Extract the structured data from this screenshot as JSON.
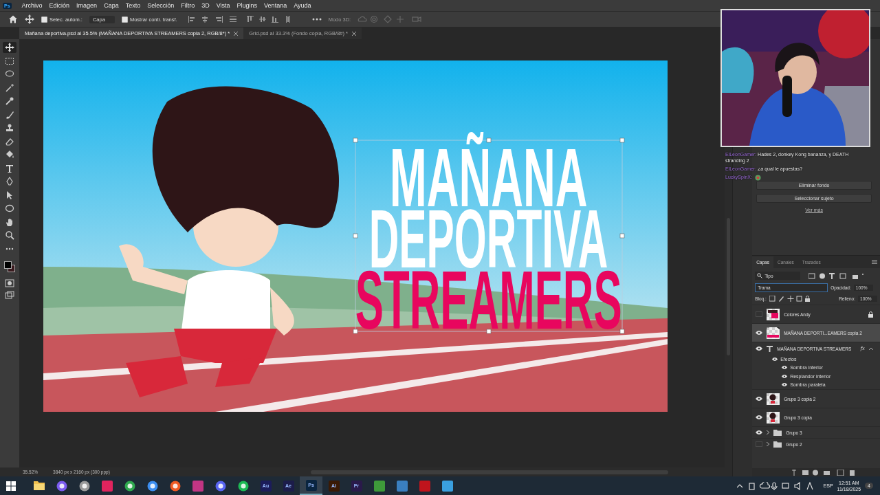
{
  "menu_bar": {
    "app_logo": "Ps",
    "items": [
      "Archivo",
      "Edición",
      "Imagen",
      "Capa",
      "Texto",
      "Selección",
      "Filtro",
      "3D",
      "Vista",
      "Plugins",
      "Ventana",
      "Ayuda"
    ]
  },
  "options_bar": {
    "auto_select": {
      "label": "Selec. autom.:",
      "checked": true
    },
    "target": "Capa",
    "transform_controls": {
      "label": "Mostrar contr. transf.",
      "checked": true
    },
    "mode_3d": "Modo 3D:"
  },
  "tabs": [
    {
      "label": "Mañana deportiva.psd al 35.5% (MAÑANA DEPORTIVA STREAMERS copia 2, RGB/8*) *",
      "selected": true
    },
    {
      "label": "Grid.psd al 33.3% (Fondo copia, RGB/8#) *",
      "selected": false
    }
  ],
  "canvas": {
    "kind": "picture",
    "title_lines": [
      {
        "text": "MAÑANA",
        "accent": false
      },
      {
        "text": "DEPORTIVA",
        "accent": false
      },
      {
        "text": "STREAMERS",
        "accent": true
      }
    ]
  },
  "chat": [
    {
      "user": "ElLeonGamer:",
      "message": "Hades 2, donkey Kong bananza, y DEATH stranding 2"
    },
    {
      "user": "ElLeonGamer:",
      "message": "¿a qual le apuestas?"
    },
    {
      "user": "LuckySpinX:"
    }
  ],
  "quick_actions": {
    "buttons": [
      "Eliminar fondo",
      "Seleccionar sujeto"
    ],
    "link": "Ver más"
  },
  "layers_panel": {
    "tabs": [
      {
        "label": "Capas",
        "selected": true
      },
      {
        "label": "Canales",
        "selected": false
      },
      {
        "label": "Trazados",
        "selected": false
      }
    ],
    "filter": "Tipo",
    "blend_mode": "Trama",
    "opacity_label": "Opacidad:",
    "opacity": "100%",
    "lock_label": "Bloq.:",
    "fill_label": "Relleno:",
    "fill": "100%",
    "layers": [
      {
        "name": "Colores Andy",
        "kind": "pixel",
        "visible": false,
        "selected": false,
        "locked": true
      },
      {
        "name": "MAÑANA DEPORTI...EAMERS copia 2",
        "kind": "smart",
        "visible": true,
        "selected": true,
        "locked": false
      },
      {
        "name": "MAÑANA DEPORTIVA STREAMERS",
        "kind": "text",
        "visible": true,
        "selected": false,
        "locked": false,
        "effects_badge": "fx",
        "effects_label": "Efectos",
        "effects": [
          "Sombra interior",
          "Resplandor interior",
          "Sombra paralela"
        ]
      },
      {
        "name": "Grupo 3 copia 2",
        "kind": "pixel",
        "visible": true,
        "selected": false,
        "locked": false
      },
      {
        "name": "Grupo 3 copia",
        "kind": "pixel",
        "visible": true,
        "selected": false,
        "locked": false
      },
      {
        "name": "Grupo 3",
        "kind": "group",
        "visible": true,
        "selected": false,
        "locked": false
      },
      {
        "name": "Grupo 2",
        "kind": "group",
        "visible": false,
        "selected": false,
        "locked": false
      }
    ]
  },
  "status_bar": {
    "zoom": "35.52%",
    "doc_info": "3840 px x 2160 px (300 ppp)"
  },
  "taskbar": {
    "apps": [
      {
        "kind": "folder",
        "active": false
      },
      {
        "kind": "ring",
        "color": "#7b5cf0",
        "active": false
      },
      {
        "kind": "ring",
        "color": "#9a9a9a",
        "active": false
      },
      {
        "kind": "tile",
        "color": "#e0245e",
        "active": false
      },
      {
        "kind": "ring",
        "color": "#2fa84f",
        "active": false
      },
      {
        "kind": "ring",
        "color": "#3c8ef0",
        "active": false
      },
      {
        "kind": "ring",
        "color": "#f05a24",
        "active": false
      },
      {
        "kind": "tile",
        "color": "#c13584",
        "active": false
      },
      {
        "kind": "ring",
        "color": "#5865f2",
        "active": false
      },
      {
        "kind": "ring",
        "color": "#1db954",
        "active": false
      },
      {
        "kind": "tile",
        "color": "#1c1c5a",
        "label": "Au",
        "active": false
      },
      {
        "kind": "tile",
        "color": "#1c1c4a",
        "label": "Ae",
        "active": false
      },
      {
        "kind": "tile",
        "color": "#0a2540",
        "label": "Ps",
        "active": true
      },
      {
        "kind": "tile",
        "color": "#3a1a05",
        "label": "Ai",
        "active": false
      },
      {
        "kind": "tile",
        "color": "#2a1a4a",
        "label": "Pr",
        "active": false
      },
      {
        "kind": "tile",
        "color": "#3e9a3a",
        "active": false
      },
      {
        "kind": "tile",
        "color": "#3a7fc0",
        "active": false
      },
      {
        "kind": "tile",
        "color": "#c0141c",
        "active": false
      },
      {
        "kind": "tile",
        "color": "#3aa0e0",
        "active": false
      }
    ],
    "language": "ESP",
    "time": "12:51 AM",
    "date": "11/18/2025",
    "notifications": "4"
  }
}
